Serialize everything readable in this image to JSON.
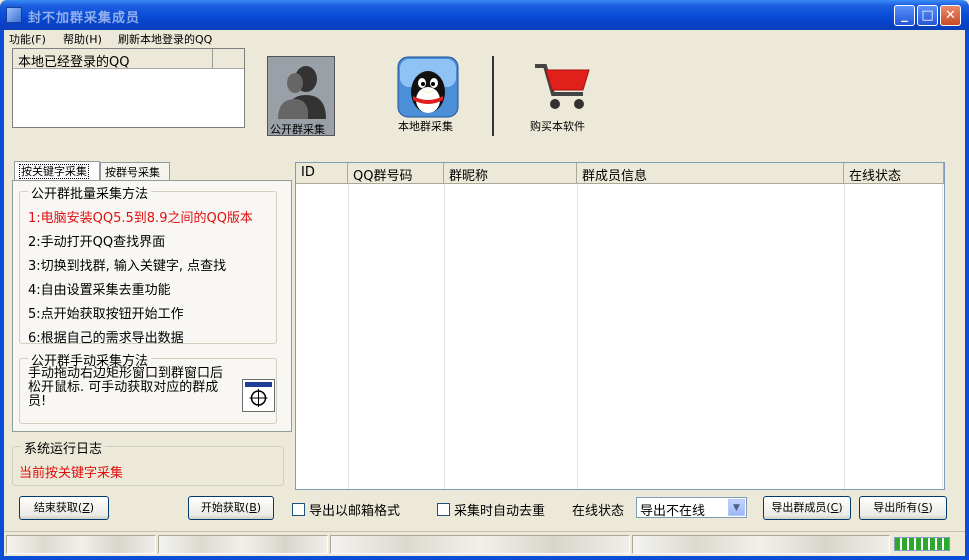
{
  "window": {
    "title": "封不加群采集成员",
    "controls": {
      "minimize": "_",
      "maximize": "□",
      "close": "✕"
    }
  },
  "menu": [
    {
      "label": "功能(F)"
    },
    {
      "label": "帮助(H)"
    },
    {
      "label": "刷新本地登录的QQ"
    }
  ],
  "login_list": {
    "header": "本地已经登录的QQ"
  },
  "toolbar": {
    "public_group": "公开群采集",
    "local_group": "本地群采集",
    "buy": "购买本软件"
  },
  "tabs": [
    {
      "label": "按关键字采集",
      "active": true
    },
    {
      "label": "按群号采集",
      "active": false
    }
  ],
  "batch_method": {
    "title": "公开群批量采集方法",
    "steps": [
      "1:电脑安装QQ5.5到8.9之间的QQ版本",
      "2:手动打开QQ查找界面",
      "3:切换到找群, 输入关键字, 点查找",
      "4:自由设置采集去重功能",
      "5:点开始获取按钮开始工作",
      "6:根据自己的需求导出数据"
    ]
  },
  "manual_method": {
    "title": "公开群手动采集方法",
    "text": "手动拖动右边矩形窗口到群窗口后松开鼠标. 可手动获取对应的群成员!"
  },
  "log": {
    "title": "系统运行日志",
    "message": "当前按关键字采集"
  },
  "grid": {
    "columns": [
      "ID",
      "QQ群号码",
      "群昵称",
      "群成员信息",
      "在线状态"
    ]
  },
  "bottom": {
    "stop": "结束获取",
    "stop_key": "Z",
    "start": "开始获取",
    "start_key": "B",
    "email_format": "导出以邮箱格式",
    "dedupe": "采集时自动去重",
    "online_label": "在线状态",
    "online_select": "导出不在线",
    "export_members": "导出群成员",
    "export_members_key": "C",
    "export_all": "导出所有",
    "export_all_key": "S"
  },
  "colors": {
    "title_bar": "#0a4ed8",
    "window_bg": "#ece9d8",
    "red_text": "#e01010",
    "cart_red": "#e0201a"
  },
  "icons": [
    "person-icon",
    "qq-penguin-icon",
    "shopping-cart-icon",
    "crosshair-icon"
  ]
}
